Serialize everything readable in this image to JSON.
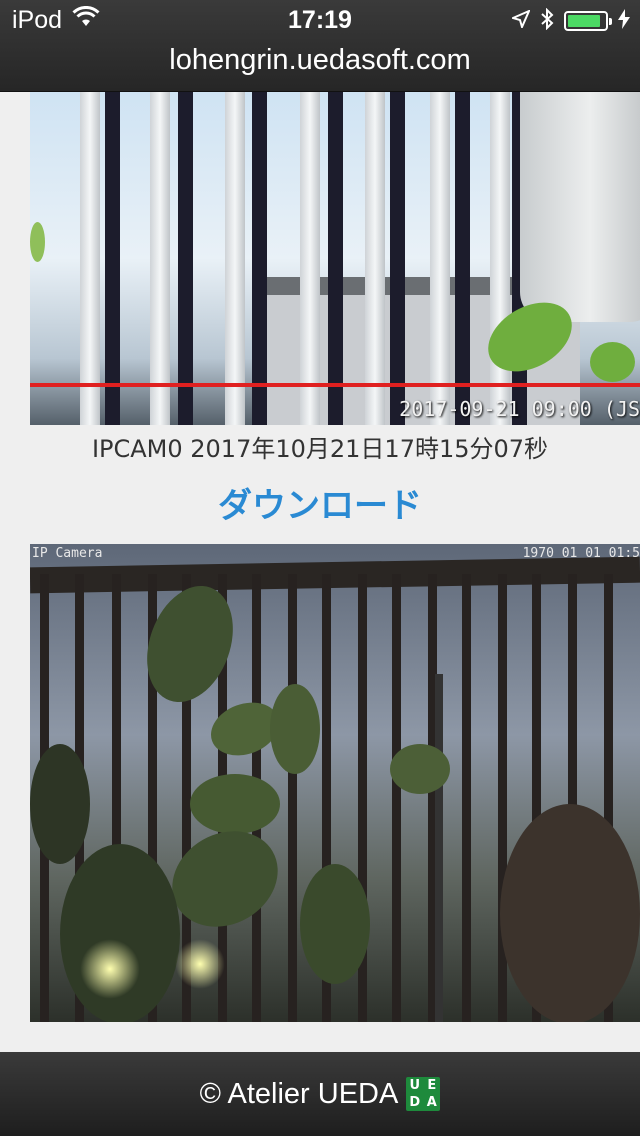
{
  "status_bar": {
    "carrier": "iPod",
    "time": "17:19",
    "battery_level": 0.9,
    "icons": [
      "wifi-icon",
      "location-arrow-icon",
      "bluetooth-icon",
      "battery-icon",
      "charging-icon"
    ]
  },
  "browser": {
    "url": "lohengrin.uedasoft.com"
  },
  "main": {
    "snapshots": [
      {
        "image_stamp": "2017-09-21 09:00 (JS",
        "caption": "IPCAM0 2017年10月21日17時15分07秒",
        "download_label": "ダウンロード"
      },
      {
        "image_label_left": "IP Camera",
        "image_label_right": "1970 01 01 01:5"
      }
    ]
  },
  "footer": {
    "copyright": "© Atelier UEDA",
    "logo_letters": [
      "U",
      "E",
      "D",
      "A"
    ],
    "logo_color": "#1e8a3c"
  },
  "colors": {
    "chrome": "#2e2e2e",
    "link": "#2a8ad3",
    "battery": "#4cd964"
  }
}
